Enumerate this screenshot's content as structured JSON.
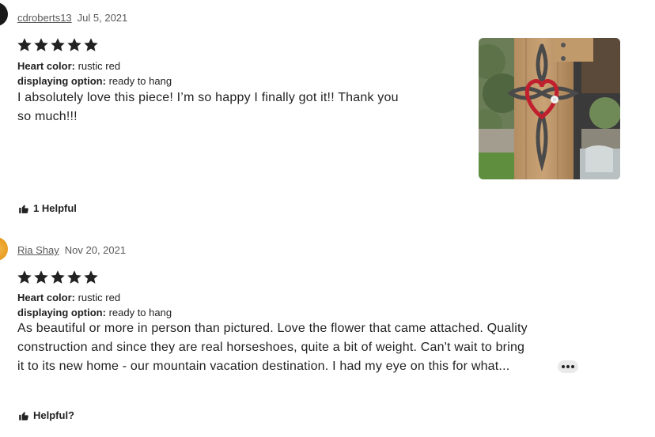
{
  "reviews": [
    {
      "username": "cdroberts13",
      "date": "Jul 5, 2021",
      "rating": 5,
      "attributes": [
        {
          "label": "Heart color:",
          "value": "rustic red"
        },
        {
          "label": "displaying option:",
          "value": "ready to hang"
        }
      ],
      "text_lines": [
        "I absolutely love this piece! I’m so happy I finally got it!! Thank you",
        "so much!!!"
      ],
      "helpful_label": "1 Helpful",
      "has_photo": true
    },
    {
      "username": "Ria Shay",
      "date": "Nov 20, 2021",
      "rating": 5,
      "attributes": [
        {
          "label": "Heart color:",
          "value": "rustic red"
        },
        {
          "label": "displaying option:",
          "value": "ready to hang"
        }
      ],
      "text_lines": [
        "As beautiful or more in person than pictured. Love the flower that came attached. Quality",
        "construction and since they are real horseshoes, quite a bit of weight. Can't wait to bring",
        "it to its new home - our mountain vacation destination. I had my eye on this for what..."
      ],
      "helpful_label": "Helpful?",
      "has_photo": false
    }
  ],
  "icons": {
    "star": "star-icon",
    "thumbs_up": "thumbs-up-icon",
    "more": "more-horizontal-icon"
  },
  "colors": {
    "star_fill": "#222222",
    "meta_text": "#595959",
    "heart_red": "#c0202e"
  }
}
